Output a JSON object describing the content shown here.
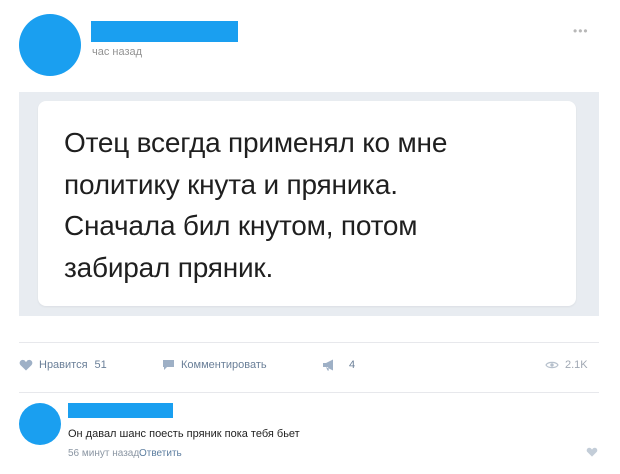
{
  "post": {
    "time": "час назад",
    "quote_lines": [
      "Отец всегда применял ко мне",
      "политику кнута и пряника.",
      "Сначала бил кнутом, потом",
      "забирал пряник."
    ]
  },
  "actions": {
    "like_label": "Нравится",
    "like_count": "51",
    "comment_label": "Комментировать",
    "share_count": "4",
    "views": "2.1K"
  },
  "comment": {
    "text": "Он давал шанс поесть пряник пока тебя бьет",
    "time": "56 минут назад",
    "reply_label": "Ответить"
  },
  "icons": {
    "like": "heart-icon",
    "comment": "speech-bubble-icon",
    "share": "megaphone-icon",
    "views": "eye-icon",
    "more": "ellipsis-icon"
  },
  "colors": {
    "avatar": "#1a9ff0",
    "action_text": "#6a7f98",
    "background_panel": "#e8ecf1"
  }
}
